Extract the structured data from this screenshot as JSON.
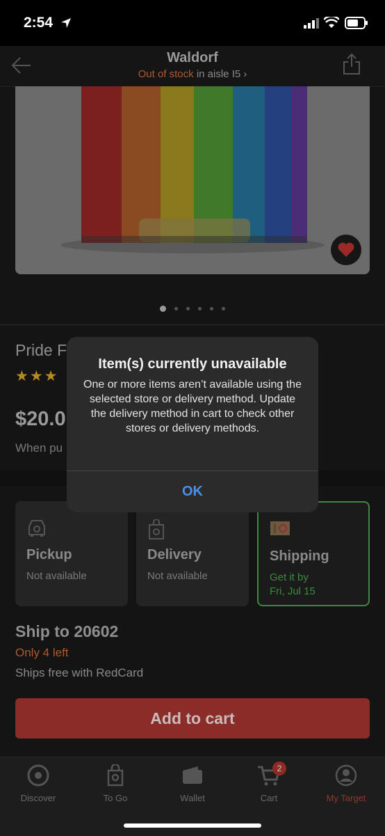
{
  "status_bar": {
    "time": "2:54"
  },
  "header": {
    "store_name": "Waldorf",
    "stock_status": "Out of stock",
    "aisle": "in aisle I5"
  },
  "product": {
    "title": "Pride F",
    "rating_stars": "★★★",
    "price": "$20.0",
    "pickup_note": "When pu"
  },
  "fulfillment": {
    "pickup": {
      "label": "Pickup",
      "status": "Not available"
    },
    "delivery": {
      "label": "Delivery",
      "status": "Not available"
    },
    "shipping": {
      "label": "Shipping",
      "status_line1": "Get it by",
      "status_line2": "Fri, Jul 15"
    }
  },
  "shipping_info": {
    "ship_to": "Ship to 20602",
    "stock_left": "Only 4 left",
    "free_ship": "Ships free with RedCard"
  },
  "add_to_cart_label": "Add to cart",
  "tabs": [
    {
      "label": "Discover"
    },
    {
      "label": "To Go"
    },
    {
      "label": "Wallet"
    },
    {
      "label": "Cart"
    },
    {
      "label": "My Target"
    }
  ],
  "cart_badge": "2",
  "alert": {
    "title": "Item(s) currently unavailable",
    "message": "One or more items aren’t available using the selected store or delivery method. Update the delivery method in cart to check other stores or delivery methods.",
    "ok_label": "OK"
  },
  "colors": {
    "accent_red": "#b1582d",
    "selected_green": "#3d8a3d",
    "alert_link": "#4a8fe8"
  }
}
